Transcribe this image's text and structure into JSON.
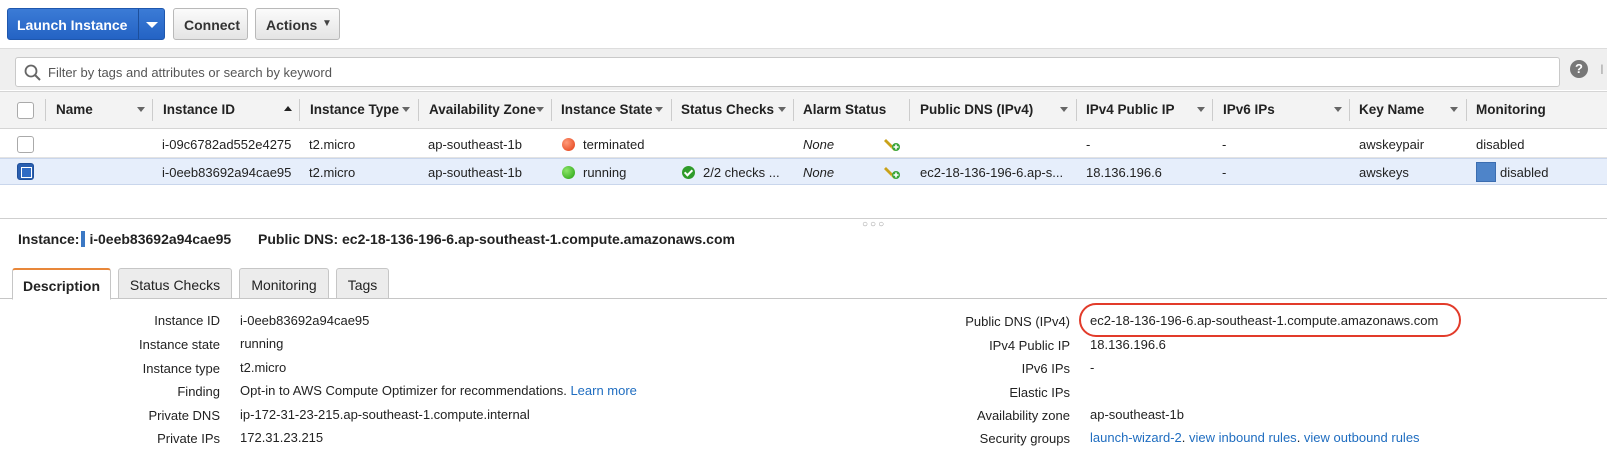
{
  "toolbar": {
    "launch_label": "Launch Instance",
    "connect_label": "Connect",
    "actions_label": "Actions"
  },
  "filter": {
    "placeholder": "Filter by tags and attributes or search by keyword",
    "help": "?",
    "edge_glyph": "I"
  },
  "columns": [
    "Name",
    "Instance ID",
    "Instance Type",
    "Availability Zone",
    "Instance State",
    "Status Checks",
    "Alarm Status",
    "Public DNS (IPv4)",
    "IPv4 Public IP",
    "IPv6 IPs",
    "Key Name",
    "Monitoring"
  ],
  "instances": [
    {
      "name": "",
      "id": "i-09c6782ad552e4275",
      "type": "t2.micro",
      "zone": "ap-southeast-1b",
      "state": "terminated",
      "status_checks": "",
      "alarm": "None",
      "public_dns": "",
      "public_ip": "-",
      "ipv6": "-",
      "key": "awskeypair",
      "monitoring": "disabled"
    },
    {
      "name": "",
      "id": "i-0eeb83692a94cae95",
      "type": "t2.micro",
      "zone": "ap-southeast-1b",
      "state": "running",
      "status_checks": "2/2 checks ...",
      "alarm": "None",
      "public_dns": "ec2-18-136-196-6.ap-s...",
      "public_ip": "18.136.196.6",
      "ipv6": "-",
      "key": "awskeys",
      "monitoring": "disabled"
    }
  ],
  "details": {
    "instance_label": "Instance:",
    "instance_id": "i-0eeb83692a94cae95",
    "dns_label": "Public DNS:",
    "dns_value": "ec2-18-136-196-6.ap-southeast-1.compute.amazonaws.com",
    "tabs": [
      "Description",
      "Status Checks",
      "Monitoring",
      "Tags"
    ],
    "left": [
      {
        "label": "Instance ID",
        "value": "i-0eeb83692a94cae95"
      },
      {
        "label": "Instance state",
        "value": "running"
      },
      {
        "label": "Instance type",
        "value": "t2.micro"
      },
      {
        "label": "Finding",
        "value": "Opt-in to AWS Compute Optimizer for recommendations.",
        "link": "Learn more"
      },
      {
        "label": "Private DNS",
        "value": "ip-172-31-23-215.ap-southeast-1.compute.internal"
      },
      {
        "label": "Private IPs",
        "value": "172.31.23.215"
      }
    ],
    "right": [
      {
        "label": "Public DNS (IPv4)",
        "value": "ec2-18-136-196-6.ap-southeast-1.compute.amazonaws.com"
      },
      {
        "label": "IPv4 Public IP",
        "value": "18.136.196.6"
      },
      {
        "label": "IPv6 IPs",
        "value": "-"
      },
      {
        "label": "Elastic IPs",
        "value": ""
      },
      {
        "label": "Availability zone",
        "value": "ap-southeast-1b"
      },
      {
        "label": "Security groups",
        "link1": "launch-wizard-2",
        "sep1": ". ",
        "link2": "view inbound rules",
        "sep2": ". ",
        "link3": "view outbound rules"
      }
    ]
  },
  "colors": {
    "primary": "#2463c4",
    "selected_row": "#e6eefb",
    "link": "#1f6dc0",
    "highlight": "#e23b2a",
    "tab_accent": "#e8873a"
  }
}
